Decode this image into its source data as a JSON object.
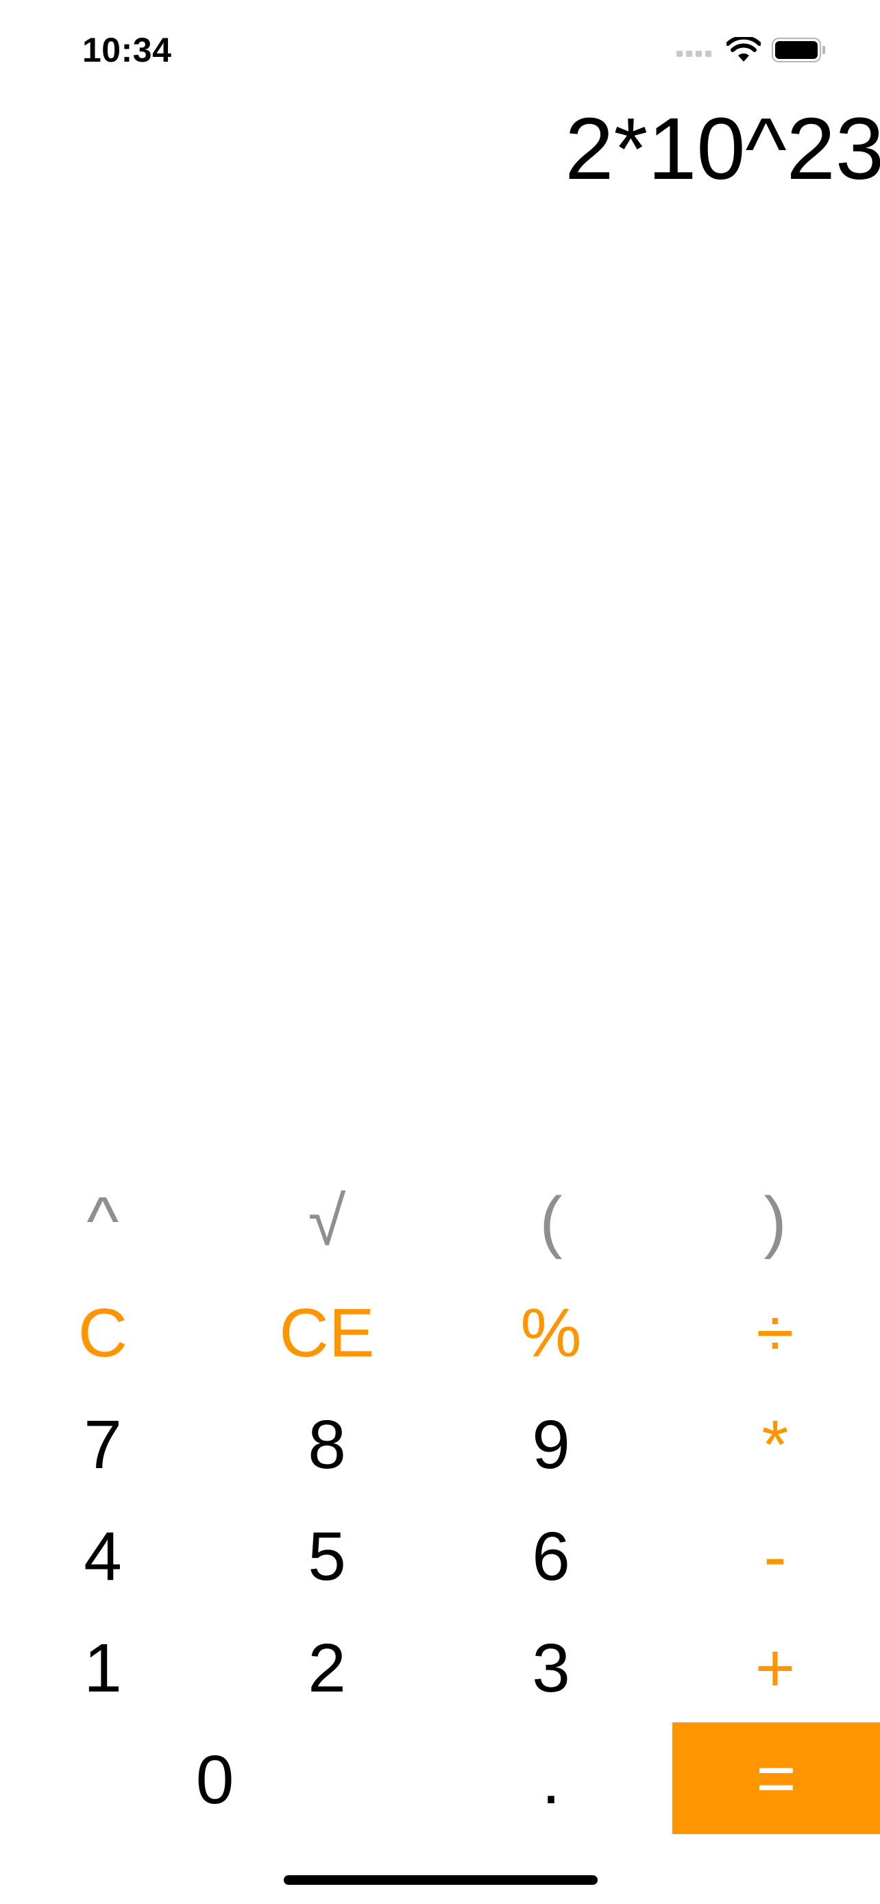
{
  "status_bar": {
    "time": "10:34"
  },
  "display": {
    "expression": "2*10^23"
  },
  "keys": {
    "power": "^",
    "sqrt": "√",
    "open_paren": "(",
    "close_paren": ")",
    "clear": "C",
    "clear_entry": "CE",
    "percent": "%",
    "divide": "÷",
    "seven": "7",
    "eight": "8",
    "nine": "9",
    "multiply": "*",
    "four": "4",
    "five": "5",
    "six": "6",
    "minus": "-",
    "one": "1",
    "two": "2",
    "three": "3",
    "plus": "+",
    "zero": "0",
    "decimal": ".",
    "equals": "="
  },
  "colors": {
    "accent": "#ff9500",
    "secondary": "#8e8e93",
    "primary": "#000000",
    "background": "#ffffff"
  }
}
